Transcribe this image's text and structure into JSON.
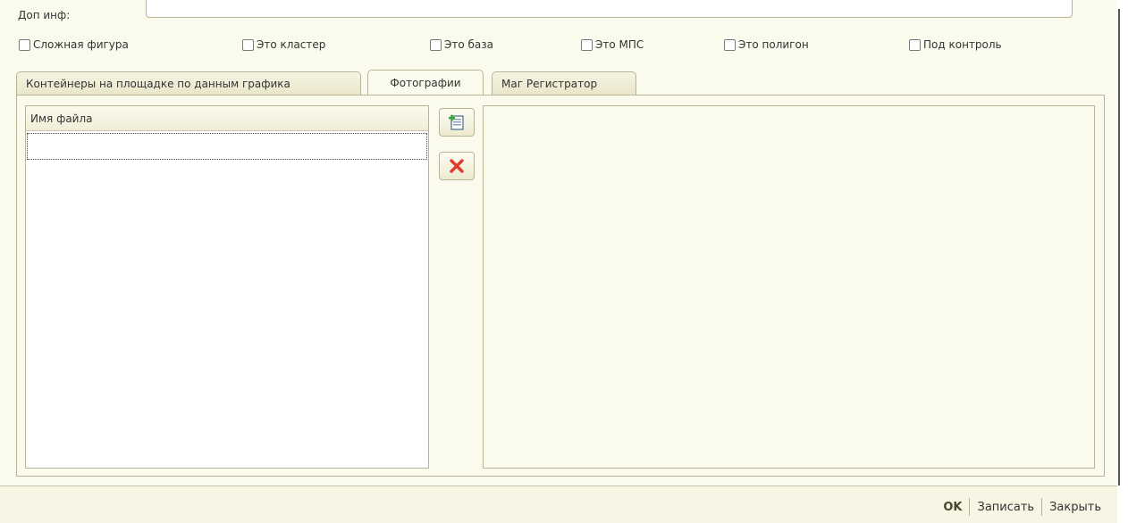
{
  "form": {
    "dop_label": "Доп инф:",
    "dop_value": ""
  },
  "checkboxes": [
    {
      "label": "Сложная фигура",
      "checked": false
    },
    {
      "label": "Это кластер",
      "checked": false
    },
    {
      "label": "Это база",
      "checked": false
    },
    {
      "label": "Это МПС",
      "checked": false
    },
    {
      "label": "Это полигон",
      "checked": false
    },
    {
      "label": "Под контроль",
      "checked": false
    }
  ],
  "tabs": [
    {
      "label": "Контейнеры на площадке по данным графика",
      "active": false
    },
    {
      "label": "Фотографии",
      "active": true
    },
    {
      "label": "Маг Регистратор",
      "active": false
    }
  ],
  "file_list": {
    "header": "Имя файла",
    "rows": [
      ""
    ]
  },
  "side_buttons": [
    {
      "icon": "add-file-icon"
    },
    {
      "icon": "delete-icon"
    }
  ],
  "footer": {
    "ok_label": "OK",
    "save_label": "Записать",
    "close_label": "Закрыть"
  },
  "colors": {
    "background": "#fbfbed",
    "border": "#b8b597",
    "delete": "#e03a2a",
    "add": "#3aa23a"
  }
}
